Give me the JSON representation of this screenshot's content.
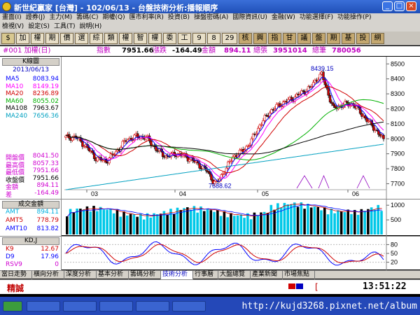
{
  "window": {
    "title": "新世紀贏家 [台灣] - 102/06/13 - 台盤技術分析:播報順序"
  },
  "menu": {
    "row1": [
      "畫面(I)",
      "證券(J)",
      "主力(M)",
      "籌碼(C)",
      "期權(Q)",
      "匯市利率(R)",
      "投資(B)",
      "操盤密碼(A)",
      "國際資訊(U)",
      "金融(W)",
      "功能選擇(F)",
      "功能操作(P)"
    ],
    "row2": [
      "檢視(V)",
      "設定(S)",
      "工具(T)",
      "說明(H)"
    ]
  },
  "toolbar": {
    "buttons": [
      "$",
      "加",
      "權",
      "期",
      "價",
      "選",
      "綜",
      "類",
      "權",
      "智",
      "權",
      "委",
      "工",
      "9",
      "8",
      "29",
      "核",
      "興",
      "指",
      "甘",
      "議",
      "盤",
      "期",
      "基",
      "投",
      "網"
    ]
  },
  "info": {
    "code": "#001 加權(日)",
    "index_label": "指數",
    "index_value": "7951.66",
    "change_label": "漲跌",
    "change_value": "-164.49",
    "amount_label": "金額",
    "amount_value": "894.11",
    "vol_label": "總張",
    "vol_value": "3951014",
    "count_label": "總筆",
    "count_value": "780056"
  },
  "kline": {
    "header": "K線圖",
    "date": "2013/06/13",
    "ma": [
      {
        "label": "MA5",
        "value": "8083.94",
        "color": "#0000ff"
      },
      {
        "label": "MA10",
        "value": "8149.19",
        "color": "#ff00ff"
      },
      {
        "label": "MA20",
        "value": "8236.89",
        "color": "#d00000"
      },
      {
        "label": "MA60",
        "value": "8055.02",
        "color": "#00b000"
      },
      {
        "label": "MA108",
        "value": "7963.67",
        "color": "#000000"
      },
      {
        "label": "MA240",
        "value": "7656.36",
        "color": "#00a0c0"
      }
    ],
    "prices": [
      {
        "label": "開盤價",
        "value": "8041.50",
        "color": "#d000d0"
      },
      {
        "label": "最高價",
        "value": "8057.33",
        "color": "#d000d0"
      },
      {
        "label": "最低價",
        "value": "7951.66",
        "color": "#d000d0"
      },
      {
        "label": "收盤價",
        "value": "7951.66",
        "color": "#000000"
      },
      {
        "label": "金額",
        "value": "894.11",
        "color": "#d000d0"
      },
      {
        "label": "差",
        "value": "-164.49",
        "color": "#d000d0"
      }
    ],
    "yticks": [
      "8500",
      "8400",
      "8300",
      "8200",
      "8100",
      "8000",
      "7900",
      "7800",
      "7700"
    ],
    "ylim": [
      7660,
      8520
    ],
    "months": [
      "03",
      "04",
      "05",
      "06"
    ],
    "high_label": "8439.15",
    "low_label": "7688.62"
  },
  "volume": {
    "header": "成交金額",
    "items": [
      {
        "label": "AMT",
        "value": "894.11",
        "color": "#00b0e0"
      },
      {
        "label": "AMT5",
        "value": "778.79",
        "color": "#d00000"
      },
      {
        "label": "AMT10",
        "value": "813.82",
        "color": "#0000ff"
      }
    ],
    "yticks": [
      "1000",
      "500"
    ],
    "ylim": [
      0,
      1100
    ]
  },
  "kd": {
    "header": "KD,J",
    "items": [
      {
        "label": "K9",
        "value": "12.67",
        "color": "#d00000"
      },
      {
        "label": "D9",
        "value": "17.96",
        "color": "#0000ff"
      },
      {
        "label": "RSV9",
        "value": "0",
        "color": "#d000d0"
      }
    ],
    "yticks": [
      "80",
      "50",
      "20"
    ],
    "ylim": [
      0,
      100
    ]
  },
  "tabs": [
    "當日走勢",
    "橫向分析",
    "深度分析",
    "基本分析",
    "籌碼分析",
    "技術分析",
    "行事曆",
    "大盤總覽",
    "產業新聞",
    "市場焦點"
  ],
  "active_tab": 5,
  "status": {
    "label": "精誠",
    "bracket": "[",
    "time": "13:51:22"
  },
  "taskbar": {
    "url": "http://kujd3268.pixnet.net/album"
  }
}
